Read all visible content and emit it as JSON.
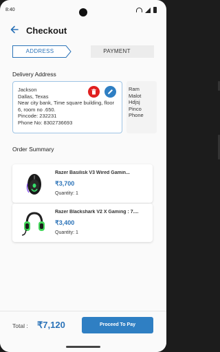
{
  "status_bar": {
    "time": "8:40"
  },
  "header": {
    "title": "Checkout",
    "back_icon": "arrow-left-icon"
  },
  "stepper": {
    "steps": [
      {
        "label": "ADDRESS",
        "active": true
      },
      {
        "label": "PAYMENT",
        "active": false
      }
    ]
  },
  "delivery": {
    "label": "Delivery Address",
    "addresses": [
      {
        "lines": [
          "Jackson",
          "Dallas, Texas",
          "Near city bank, Time square building, floor",
          "6, room no .650.",
          "Pincode: 232231",
          "Phone No: 8302736693"
        ]
      },
      {
        "lines": [
          "Ram",
          "Malot",
          "Hdjsj",
          "Pinco",
          "Phone"
        ]
      }
    ],
    "add_icon": "+"
  },
  "order": {
    "label": "Order Summary",
    "items": [
      {
        "name": "Razer Basilisk V3 Wired Gamin...",
        "price": "₹3,700",
        "quantity": "Quantity: 1",
        "image": "mouse-image"
      },
      {
        "name": "Razer Blackshark V2 X Gaming : 7....",
        "price": "₹3,400",
        "quantity": "Quantity: 1",
        "image": "headset-image"
      }
    ]
  },
  "footer": {
    "total_label": "Total :",
    "total_value": "₹7,120",
    "button": "Proceed To Pay"
  },
  "colors": {
    "accent": "#2b73b8",
    "button": "#2f7fc3",
    "delete": "#e02020"
  }
}
